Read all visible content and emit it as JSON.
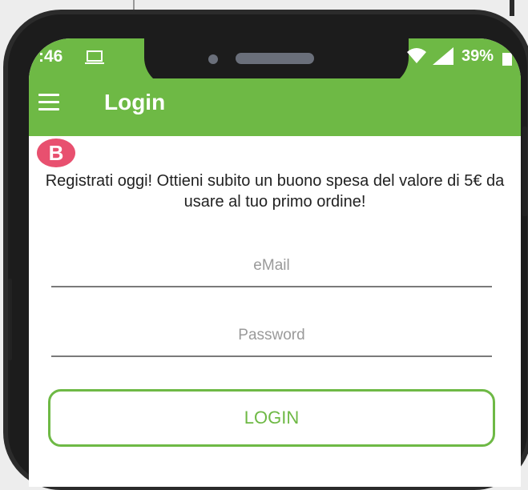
{
  "status_bar": {
    "time": ":46",
    "battery": "39%",
    "icons": [
      "laptop-icon",
      "wifi-icon",
      "signal-icon",
      "battery-icon"
    ]
  },
  "app_bar": {
    "title": "Login",
    "menu_icon": "hamburger-menu-icon"
  },
  "badge": {
    "letter": "B",
    "color": "#e8506f"
  },
  "promo_text": "Registrati oggi! Ottieni subito un buono spesa del valore di 5€ da usare al tuo primo ordine!",
  "form": {
    "email_placeholder": "eMail",
    "password_placeholder": "Password",
    "login_label": "LOGIN"
  },
  "colors": {
    "accent": "#6eb945",
    "badge": "#e8506f"
  }
}
